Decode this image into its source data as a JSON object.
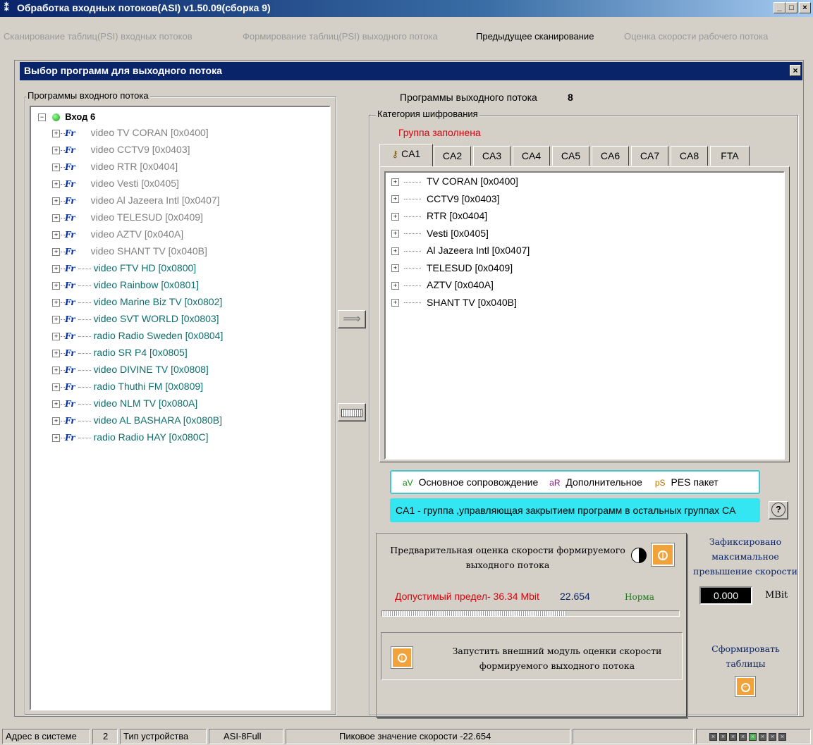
{
  "window": {
    "title": "Обработка входных потоков(ASI)  v1.50.09(сборка 9)",
    "minimize": "_",
    "maximize": "□",
    "close": "×"
  },
  "menu": [
    "Сканирование таблиц(PSI) входных потоков",
    "Формирование таблиц(PSI) выходного потока",
    "Предыдущее сканирование",
    "Оценка скорости рабочего потока"
  ],
  "dialog": {
    "title": "Выбор программ для выходного потока",
    "close": "×"
  },
  "input_panel": {
    "label": "Программы входного потока",
    "root": "Вход 6",
    "items": [
      {
        "type": "video",
        "name": "TV CORAN [0x0400]",
        "tag": "Fr",
        "style": "gray"
      },
      {
        "type": "video",
        "name": "CCTV9 [0x0403]",
        "tag": "Fr",
        "style": "gray"
      },
      {
        "type": "video",
        "name": "RTR [0x0404]",
        "tag": "Fr",
        "style": "gray"
      },
      {
        "type": "video",
        "name": "Vesti [0x0405]",
        "tag": "Fr",
        "style": "gray"
      },
      {
        "type": "video",
        "name": "Al Jazeera Intl [0x0407]",
        "tag": "Fr",
        "style": "gray"
      },
      {
        "type": "video",
        "name": "TELESUD [0x0409]",
        "tag": "Fr",
        "style": "gray"
      },
      {
        "type": "video",
        "name": "AZTV [0x040A]",
        "tag": "Fr",
        "style": "gray"
      },
      {
        "type": "video",
        "name": "SHANT TV [0x040B]",
        "tag": "Fr",
        "style": "gray"
      },
      {
        "type": "video",
        "name": "FTV HD [0x0800]",
        "tag": "Fr",
        "style": "teal"
      },
      {
        "type": "video",
        "name": "Rainbow [0x0801]",
        "tag": "Fr",
        "style": "teal"
      },
      {
        "type": "video",
        "name": "Marine Biz TV [0x0802]",
        "tag": "Fr",
        "style": "teal"
      },
      {
        "type": "video",
        "name": "SVT WORLD [0x0803]",
        "tag": "Fr",
        "style": "teal"
      },
      {
        "type": "radio",
        "name": "Radio Sweden [0x0804]",
        "tag": "Fr",
        "style": "teal"
      },
      {
        "type": "radio",
        "name": "SR P4 [0x0805]",
        "tag": "Fr",
        "style": "teal"
      },
      {
        "type": "video",
        "name": "DIVINE TV [0x0808]",
        "tag": "Fr",
        "style": "teal"
      },
      {
        "type": "radio",
        "name": "Thuthi FM [0x0809]",
        "tag": "Fr",
        "style": "teal"
      },
      {
        "type": "video",
        "name": "NLM TV [0x080A]",
        "tag": "Fr",
        "style": "teal"
      },
      {
        "type": "video",
        "name": "AL BASHARA [0x080B]",
        "tag": "Fr",
        "style": "teal"
      },
      {
        "type": "radio",
        "name": "Radio HAY [0x080C]",
        "tag": "Fr",
        "style": "teal"
      }
    ]
  },
  "output_panel": {
    "label": "Программы выходного потока",
    "count": "8",
    "category_label": "Категория шифрования",
    "group_full": "Группа заполнена",
    "tabs": [
      "CA1",
      "CA2",
      "CA3",
      "CA4",
      "CA5",
      "CA6",
      "CA7",
      "CA8",
      "FTA"
    ],
    "active_tab": "CA1",
    "items": [
      "TV CORAN [0x0400]",
      "CCTV9 [0x0403]",
      "RTR [0x0404]",
      "Vesti [0x0405]",
      "Al Jazeera Intl [0x0407]",
      "TELESUD [0x0409]",
      "AZTV [0x040A]",
      "SHANT TV [0x040B]"
    ]
  },
  "legend": {
    "av_icon": "aV",
    "av_text": "Основное сопровождение",
    "ar_icon": "aR",
    "ar_text": "Дополнительное",
    "ps_icon": "pS",
    "ps_text": "PES пакет"
  },
  "ca1_note": "CA1 - группа ,управляющая закрытием программ в остальных группах CA",
  "help_icon": "?",
  "speed": {
    "title_line1": "Предварительная оценка скорости  формируемого",
    "title_line2": "выходного  потока",
    "limit": "Допустимый предел- 36.34 Mbit",
    "value": "22.654",
    "status": "Норма",
    "progress": 0.62,
    "ext_line1": "Запустить внешний модуль  оценки скорости",
    "ext_line2": "формируемого выходного потока"
  },
  "excess": {
    "label_line1": "Зафиксировано",
    "label_line2": "максимальное",
    "label_line3": "превышение скорости",
    "value": "0.000",
    "unit": "MBit"
  },
  "form_tables": {
    "line1": "Сформировать",
    "line2": "таблицы"
  },
  "statusbar": {
    "addr_label": "Адрес в системе",
    "addr_value": "2",
    "device_label": "Тип устройства",
    "device_value": "ASI-8Full",
    "peak": "Пиковое значение скорости -22.654"
  },
  "colors": {
    "title_bg": "#0a246a",
    "accent_cyan": "#33e6f2",
    "red_text": "#e0000a",
    "teal_text": "#0e6e6e",
    "orange_btn": "#f2a23a"
  }
}
